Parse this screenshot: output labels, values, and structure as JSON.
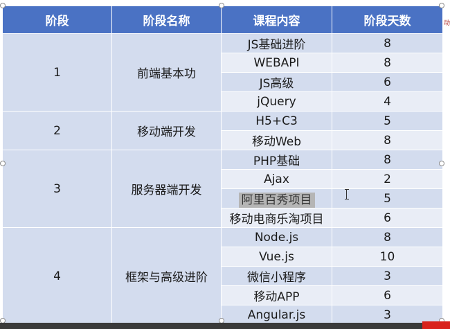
{
  "headers": [
    "阶段",
    "阶段名称",
    "课程内容",
    "阶段天数"
  ],
  "stages": [
    {
      "number": "1",
      "name": "前端基本功"
    },
    {
      "number": "2",
      "name": "移动端开发"
    },
    {
      "number": "3",
      "name": "服务器端开发"
    },
    {
      "number": "4",
      "name": "框架与高级进阶"
    }
  ],
  "rows": [
    {
      "course": "JS基础进阶",
      "days": "8"
    },
    {
      "course": "WEBAPI",
      "days": "8"
    },
    {
      "course": "JS高级",
      "days": "6"
    },
    {
      "course": "jQuery",
      "days": "4"
    },
    {
      "course": "H5+C3",
      "days": "5"
    },
    {
      "course": "移动Web",
      "days": "8"
    },
    {
      "course": "PHP基础",
      "days": "8"
    },
    {
      "course": "Ajax",
      "days": "2"
    },
    {
      "course": "阿里百秀项目",
      "days": "5"
    },
    {
      "course": "移动电商乐淘项目",
      "days": "6"
    },
    {
      "course": "Node.js",
      "days": "8"
    },
    {
      "course": "Vue.js",
      "days": "10"
    },
    {
      "course": "微信小程序",
      "days": "3"
    },
    {
      "course": "移动APP",
      "days": "6"
    },
    {
      "course": "Angular.js",
      "days": "3"
    }
  ],
  "edge_label": "动",
  "colors": {
    "header": "#4a72c4",
    "row_dark": "#d3dcee",
    "row_light": "#e9edf6",
    "selection": "#b5b5b5"
  }
}
